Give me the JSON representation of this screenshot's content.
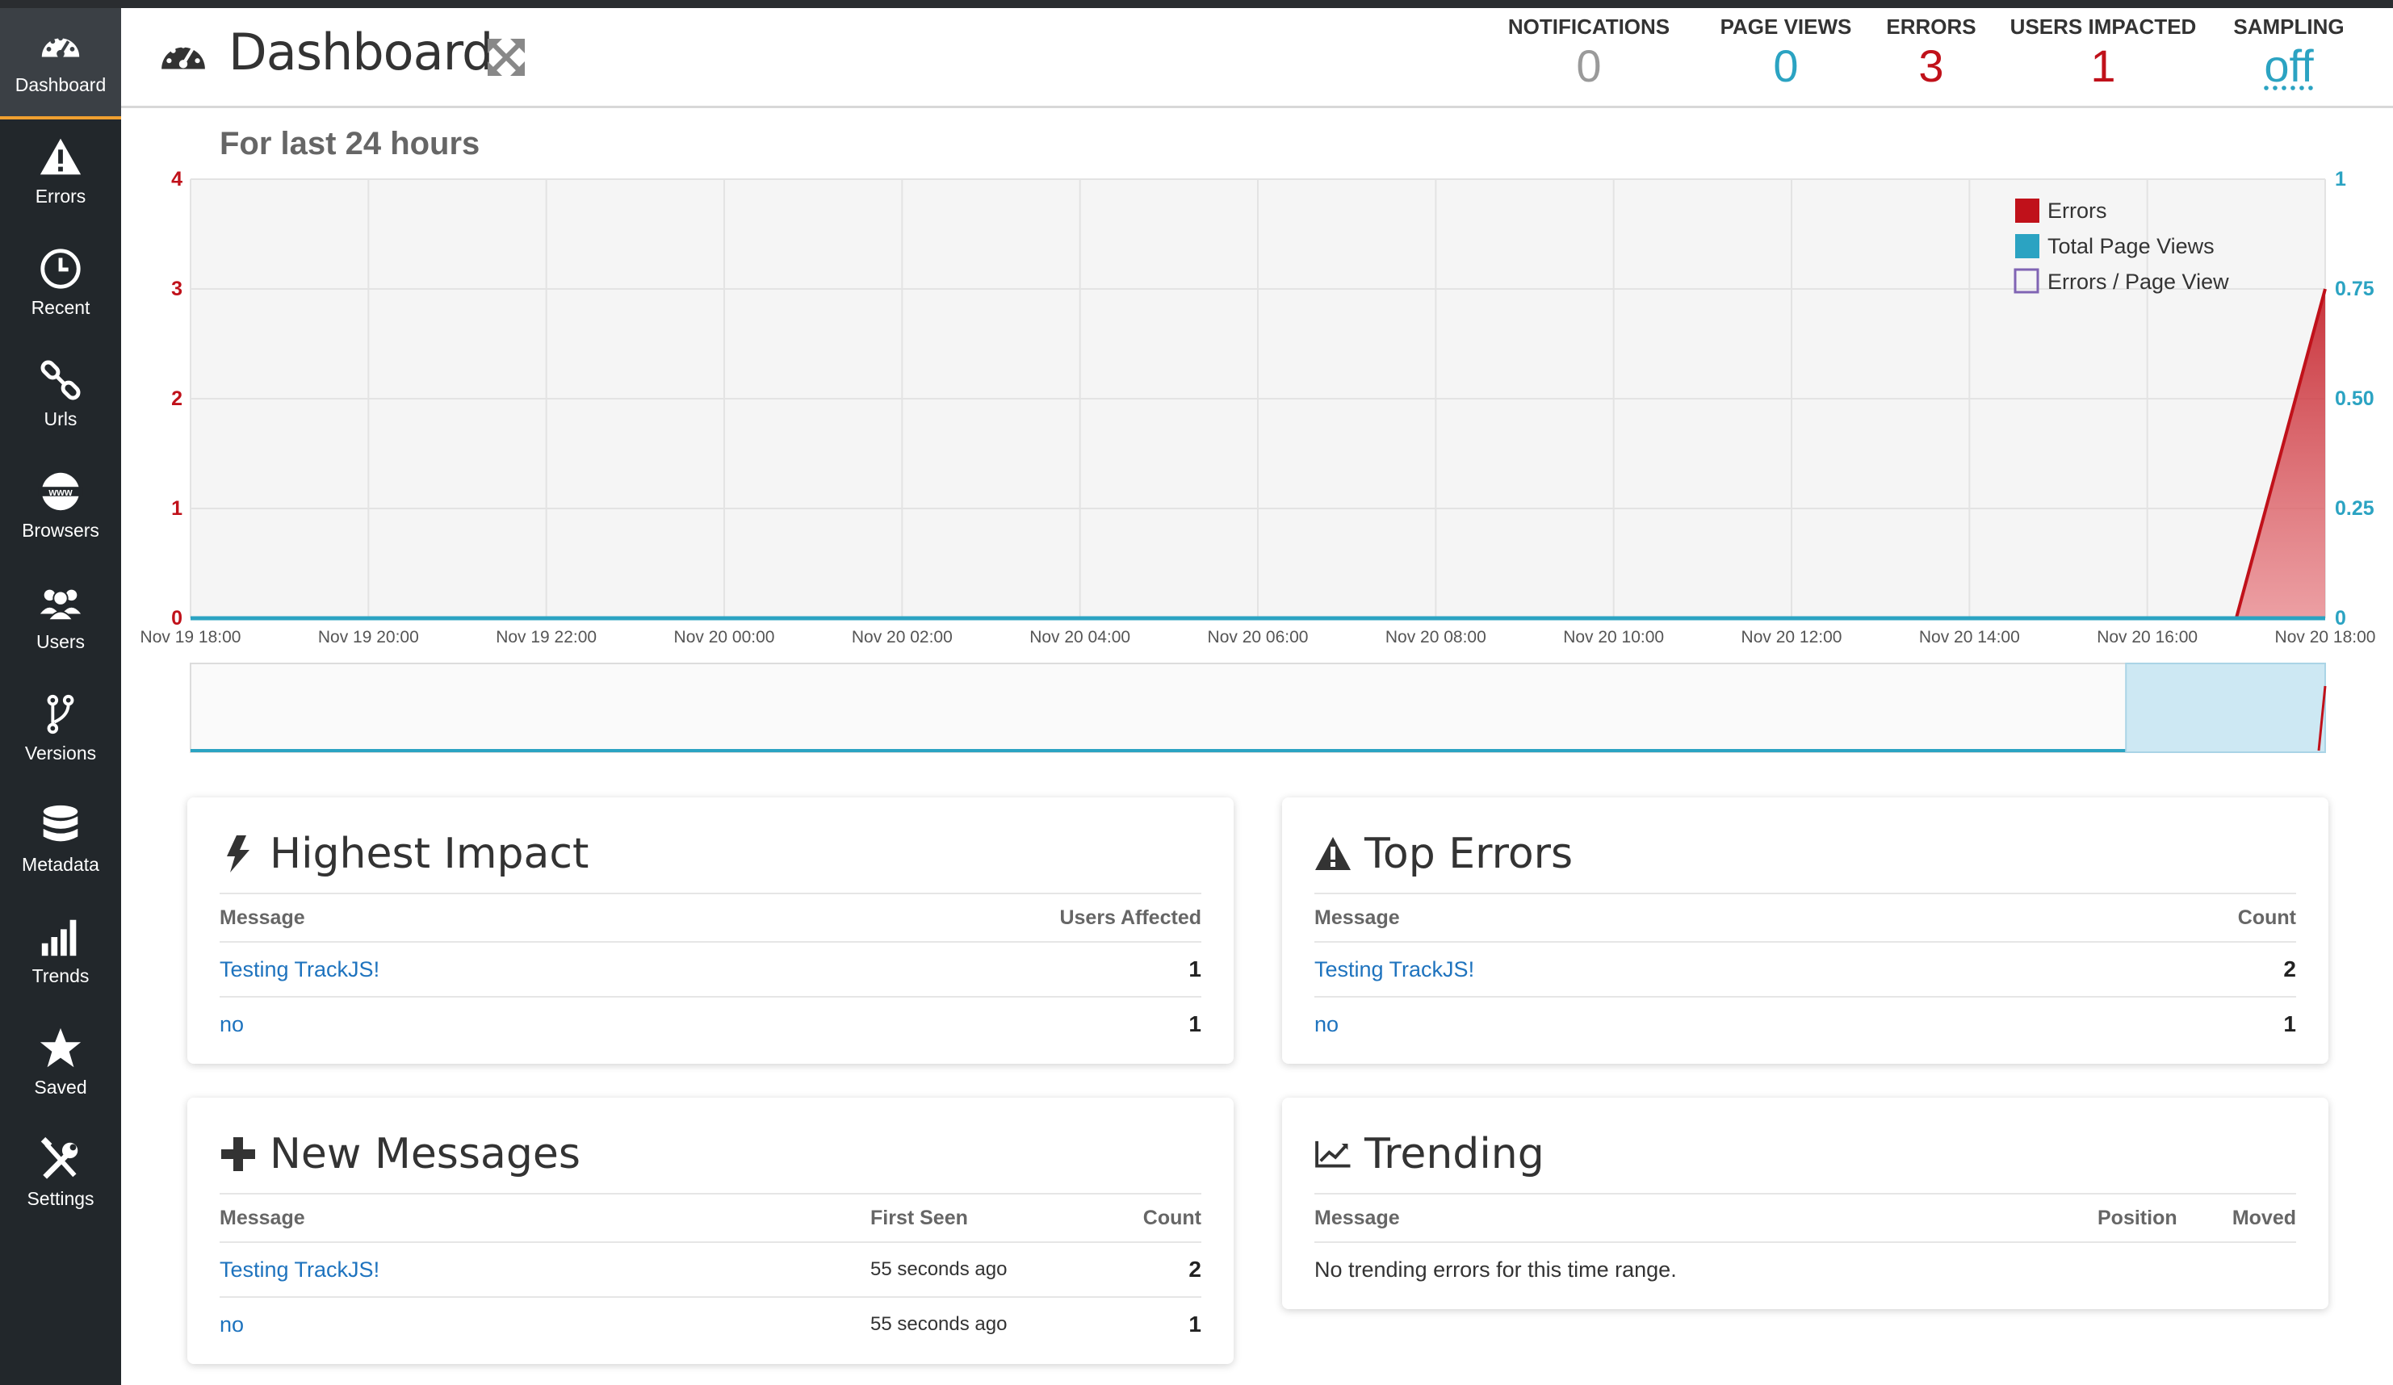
{
  "sidebar": {
    "items": [
      {
        "label": "Dashboard",
        "icon": "dashboard-icon"
      },
      {
        "label": "Errors",
        "icon": "warning-icon"
      },
      {
        "label": "Recent",
        "icon": "clock-icon"
      },
      {
        "label": "Urls",
        "icon": "link-icon"
      },
      {
        "label": "Browsers",
        "icon": "www-globe-icon"
      },
      {
        "label": "Users",
        "icon": "users-icon"
      },
      {
        "label": "Versions",
        "icon": "branch-icon"
      },
      {
        "label": "Metadata",
        "icon": "database-icon"
      },
      {
        "label": "Trends",
        "icon": "bar-chart-icon"
      },
      {
        "label": "Saved",
        "icon": "star-icon"
      },
      {
        "label": "Settings",
        "icon": "wrench-screwdriver-icon"
      }
    ]
  },
  "header": {
    "title": "Dashboard",
    "stats": {
      "notifications": {
        "label": "NOTIFICATIONS",
        "value": "0",
        "color": "#9a9a9a"
      },
      "page_views": {
        "label": "PAGE VIEWS",
        "value": "0",
        "color": "#2ba3c2"
      },
      "errors": {
        "label": "ERRORS",
        "value": "3",
        "color": "#c0111a"
      },
      "users_impacted": {
        "label": "USERS IMPACTED",
        "value": "1",
        "color": "#c0111a"
      },
      "sampling": {
        "label": "SAMPLING",
        "value": "off",
        "color": "#2ba3c2"
      }
    }
  },
  "chart_title": "For last 24 hours",
  "chart_data": {
    "type": "area",
    "x": [
      "Nov 19 18:00",
      "Nov 19 20:00",
      "Nov 19 22:00",
      "Nov 20 00:00",
      "Nov 20 02:00",
      "Nov 20 04:00",
      "Nov 20 06:00",
      "Nov 20 08:00",
      "Nov 20 10:00",
      "Nov 20 12:00",
      "Nov 20 14:00",
      "Nov 20 16:00",
      "Nov 20 18:00"
    ],
    "y_left_ticks": [
      "0",
      "1",
      "2",
      "3",
      "4"
    ],
    "y_right_ticks": [
      "0",
      "0.25",
      "0.50",
      "0.75",
      "1"
    ],
    "ylim_left": [
      0,
      4
    ],
    "ylim_right": [
      0,
      1
    ],
    "series": [
      {
        "name": "Errors",
        "color": "#c0111a",
        "points": [
          [
            "Nov 20 17:00",
            0
          ],
          [
            "Nov 20 18:00",
            3
          ]
        ]
      },
      {
        "name": "Total Page Views",
        "color": "#2ba3c2",
        "points": [
          [
            "Nov 19 18:00",
            0
          ],
          [
            "Nov 20 18:00",
            0
          ]
        ]
      },
      {
        "name": "Errors / Page View",
        "color": "#8064b4",
        "points": []
      }
    ],
    "legend": "top-right",
    "grid": true
  },
  "panels": {
    "highest_impact": {
      "title": "Highest Impact",
      "columns": [
        "Message",
        "Users Affected"
      ],
      "rows": [
        {
          "message": "Testing TrackJS!",
          "value": "1"
        },
        {
          "message": "no",
          "value": "1"
        }
      ]
    },
    "top_errors": {
      "title": "Top Errors",
      "columns": [
        "Message",
        "Count"
      ],
      "rows": [
        {
          "message": "Testing TrackJS!",
          "value": "2"
        },
        {
          "message": "no",
          "value": "1"
        }
      ]
    },
    "new_messages": {
      "title": "New Messages",
      "columns": [
        "Message",
        "First Seen",
        "Count"
      ],
      "rows": [
        {
          "message": "Testing TrackJS!",
          "first_seen": "55 seconds ago",
          "value": "2"
        },
        {
          "message": "no",
          "first_seen": "55 seconds ago",
          "value": "1"
        }
      ]
    },
    "trending": {
      "title": "Trending",
      "columns": [
        "Message",
        "Position",
        "Moved"
      ],
      "empty_text": "No trending errors for this time range."
    }
  }
}
